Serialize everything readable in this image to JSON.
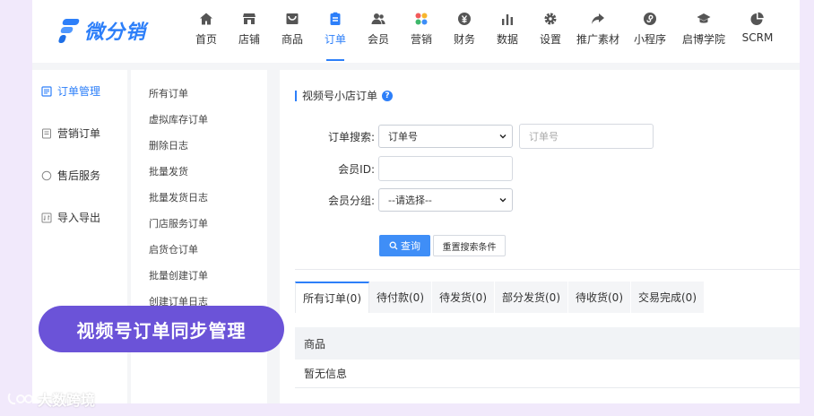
{
  "brand": {
    "name": "微分销",
    "color": "#2d7ff9"
  },
  "nav": [
    {
      "label": "首页",
      "icon": "home-icon"
    },
    {
      "label": "店铺",
      "icon": "store-icon"
    },
    {
      "label": "商品",
      "icon": "product-box-icon"
    },
    {
      "label": "订单",
      "icon": "order-clipboard-icon",
      "active": true
    },
    {
      "label": "会员",
      "icon": "members-icon"
    },
    {
      "label": "营销",
      "icon": "marketing-grid-icon"
    },
    {
      "label": "财务",
      "icon": "finance-coin-icon"
    },
    {
      "label": "数据",
      "icon": "data-bars-icon"
    },
    {
      "label": "设置",
      "icon": "settings-gear-icon"
    },
    {
      "label": "推广素材",
      "icon": "share-arrow-icon"
    },
    {
      "label": "小程序",
      "icon": "mini-program-icon"
    },
    {
      "label": "启博学院",
      "icon": "graduation-cap-icon"
    },
    {
      "label": "SCRM",
      "icon": "pie-chart-icon"
    }
  ],
  "sidebar_primary": [
    {
      "label": "订单管理",
      "icon": "order-list-icon",
      "active": true
    },
    {
      "label": "营销订单",
      "icon": "marketing-order-icon"
    },
    {
      "label": "售后服务",
      "icon": "after-sales-icon"
    },
    {
      "label": "导入导出",
      "icon": "import-export-icon"
    }
  ],
  "sidebar_secondary": [
    "所有订单",
    "虚拟库存订单",
    "删除日志",
    "批量发货",
    "批量发货日志",
    "门店服务订单",
    "启货仓订单",
    "批量创建订单",
    "创建订单日志"
  ],
  "panel": {
    "title": "视频号小店订单",
    "help": "?"
  },
  "search_form": {
    "order_search_label": "订单搜索:",
    "order_search_type": "订单号",
    "order_search_placeholder": "订单号",
    "member_id_label": "会员ID:",
    "member_id_value": "",
    "member_group_label": "会员分组:",
    "member_group_value": "--请选择--",
    "search_button": "查询",
    "reset_button": "重置搜索条件"
  },
  "tabs": [
    {
      "label": "所有订单(0)",
      "active": true
    },
    {
      "label": "待付款(0)"
    },
    {
      "label": "待发货(0)"
    },
    {
      "label": "部分发货(0)"
    },
    {
      "label": "待收货(0)"
    },
    {
      "label": "交易完成(0)"
    }
  ],
  "table": {
    "header": "商品",
    "empty_text": "暂无信息"
  },
  "banner": {
    "text": "视频号订单同步管理",
    "color": "#6b53d8"
  },
  "watermark": {
    "text": "大数跨境"
  }
}
